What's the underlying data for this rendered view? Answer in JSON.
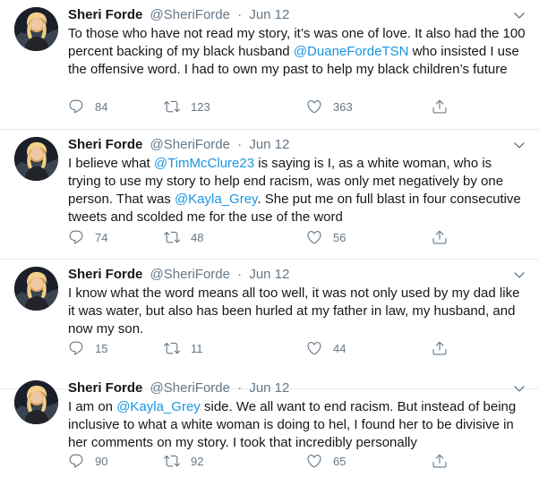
{
  "tweets": [
    {
      "name": "Sheri Forde",
      "handle": "@SheriForde",
      "separator": "·",
      "date": "Jun 12",
      "text": [
        {
          "type": "text",
          "value": "To those who have not read my story, it’s was one of love. It also had the 100 percent backing of my black husband "
        },
        {
          "type": "mention",
          "value": "@DuaneFordeTSN"
        },
        {
          "type": "text",
          "value": " who insisted I use the offensive word. I had to own my past to help my black children’s future"
        }
      ],
      "replies": "84",
      "retweets": "123",
      "likes": "363"
    },
    {
      "name": "Sheri Forde",
      "handle": "@SheriForde",
      "separator": "·",
      "date": "Jun 12",
      "text": [
        {
          "type": "text",
          "value": "I believe what "
        },
        {
          "type": "mention",
          "value": "@TimMcClure23"
        },
        {
          "type": "text",
          "value": " is saying is I, as a white woman, who is trying to use my story to help end racism, was only met negatively by one person. That was "
        },
        {
          "type": "mention",
          "value": "@Kayla_Grey"
        },
        {
          "type": "text",
          "value": ". She put me on full blast in four consecutive tweets and scolded me for the use of the word"
        }
      ],
      "replies": "74",
      "retweets": "48",
      "likes": "56"
    },
    {
      "name": "Sheri Forde",
      "handle": "@SheriForde",
      "separator": "·",
      "date": "Jun 12",
      "text": [
        {
          "type": "text",
          "value": "I know what the word means all too well, it was not only used by my dad like it was water, but also has been hurled at my father in law, my husband, and now my son."
        }
      ],
      "replies": "15",
      "retweets": "11",
      "likes": "44"
    },
    {
      "name": "Sheri Forde",
      "handle": "@SheriForde",
      "separator": "·",
      "date": "Jun 12",
      "text": [
        {
          "type": "text",
          "value": "I am on "
        },
        {
          "type": "mention",
          "value": "@Kayla_Grey"
        },
        {
          "type": "text",
          "value": " side. We all want to end racism. But instead of being inclusive to what a white woman is doing to hel, I found her to be divisive in her comments on my story. I took that incredibly personally"
        }
      ],
      "replies": "90",
      "retweets": "92",
      "likes": "65"
    }
  ],
  "icons": {
    "reply": "reply-icon",
    "retweet": "retweet-icon",
    "like": "heart-icon",
    "share": "share-icon",
    "caret": "chevron-down-icon"
  },
  "colors": {
    "mention": "#1b95e0",
    "secondary_text": "#657786",
    "primary_text": "#14171a",
    "divider": "#e6ecf0"
  }
}
